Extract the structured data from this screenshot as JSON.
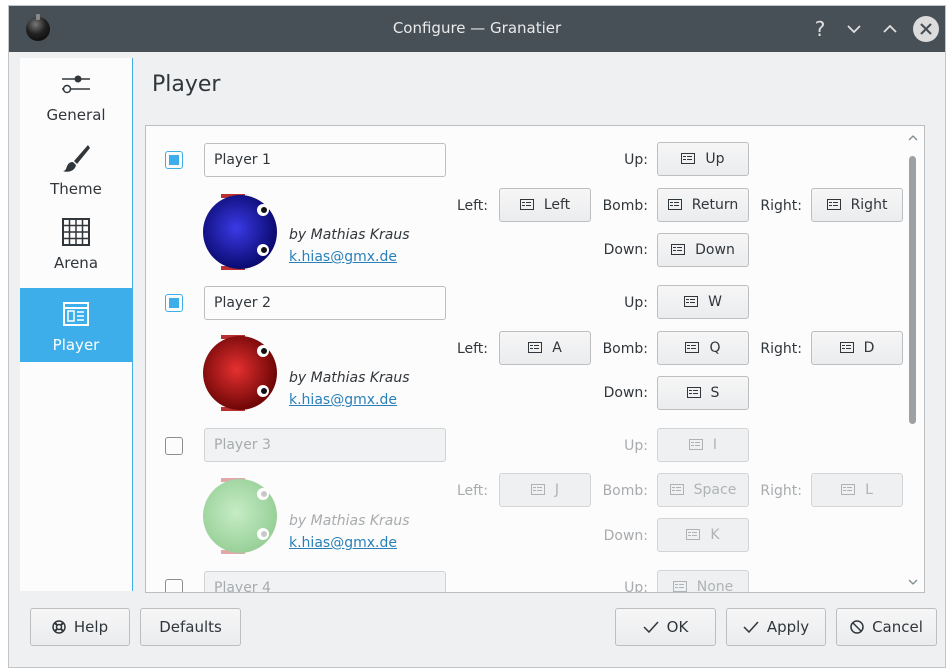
{
  "window": {
    "title": "Configure — Granatier"
  },
  "titlebar": {
    "help": "?",
    "minimize": "⌵",
    "maximize": "⌃",
    "close": "✕"
  },
  "sidebar": {
    "items": [
      {
        "label": "General",
        "icon": "sliders-icon"
      },
      {
        "label": "Theme",
        "icon": "brush-icon"
      },
      {
        "label": "Arena",
        "icon": "grid-icon"
      },
      {
        "label": "Player",
        "icon": "player-icon",
        "active": true
      }
    ]
  },
  "page": {
    "title": "Player"
  },
  "key_labels": {
    "up": "Up:",
    "left": "Left:",
    "bomb": "Bomb:",
    "right": "Right:",
    "down": "Down:"
  },
  "players": [
    {
      "name": "Player 1",
      "enabled": true,
      "author": "by Mathias Kraus",
      "email": "k.hias@gmx.de",
      "keys": {
        "up": "Up",
        "left": "Left",
        "bomb": "Return",
        "right": "Right",
        "down": "Down"
      },
      "color": "#1a1aa6"
    },
    {
      "name": "Player 2",
      "enabled": true,
      "author": "by Mathias Kraus",
      "email": "k.hias@gmx.de",
      "keys": {
        "up": "W",
        "left": "A",
        "bomb": "Q",
        "right": "D",
        "down": "S"
      },
      "color": "#a61414"
    },
    {
      "name": "Player 3",
      "enabled": false,
      "author": "by Mathias Kraus",
      "email": "k.hias@gmx.de",
      "keys": {
        "up": "I",
        "left": "J",
        "bomb": "Space",
        "right": "L",
        "down": "K"
      },
      "color": "#a8dba8"
    },
    {
      "name": "Player 4",
      "enabled": false,
      "keys": {
        "up": "None"
      }
    }
  ],
  "buttons": {
    "help": "Help",
    "defaults": "Defaults",
    "ok": "OK",
    "apply": "Apply",
    "cancel": "Cancel"
  },
  "colors": {
    "accent": "#3daee9",
    "titlebar": "#475057",
    "link": "#2980b9"
  }
}
